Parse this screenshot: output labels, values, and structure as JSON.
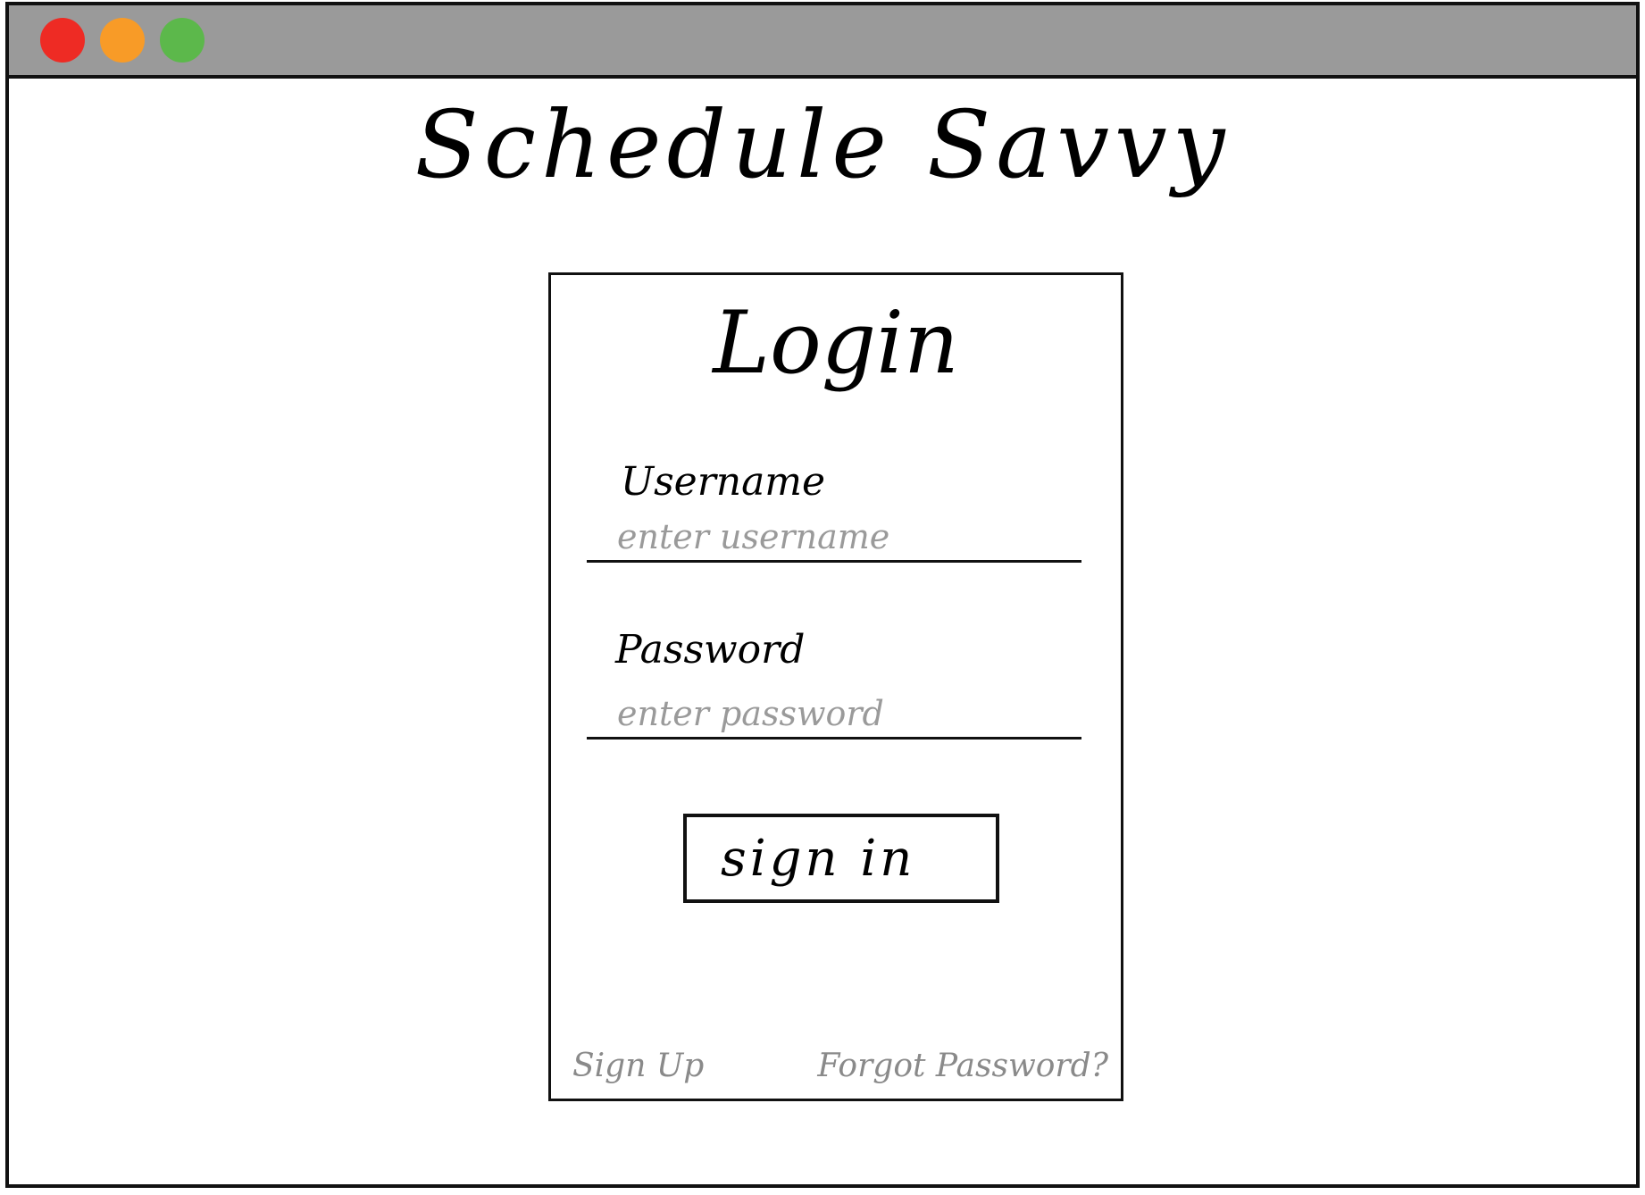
{
  "window": {
    "controls": {
      "close_color": "#ee2b24",
      "minimize_color": "#f89b27",
      "maximize_color": "#5cb84b"
    }
  },
  "app": {
    "title": "Schedule Savvy"
  },
  "login_card": {
    "title": "Login",
    "username": {
      "label": "Username",
      "placeholder": "enter username",
      "value": ""
    },
    "password": {
      "label": "Password",
      "placeholder": "enter password",
      "value": ""
    },
    "submit_label": "sign in",
    "signup_link": "Sign Up",
    "forgot_link": "Forgot Password?"
  }
}
